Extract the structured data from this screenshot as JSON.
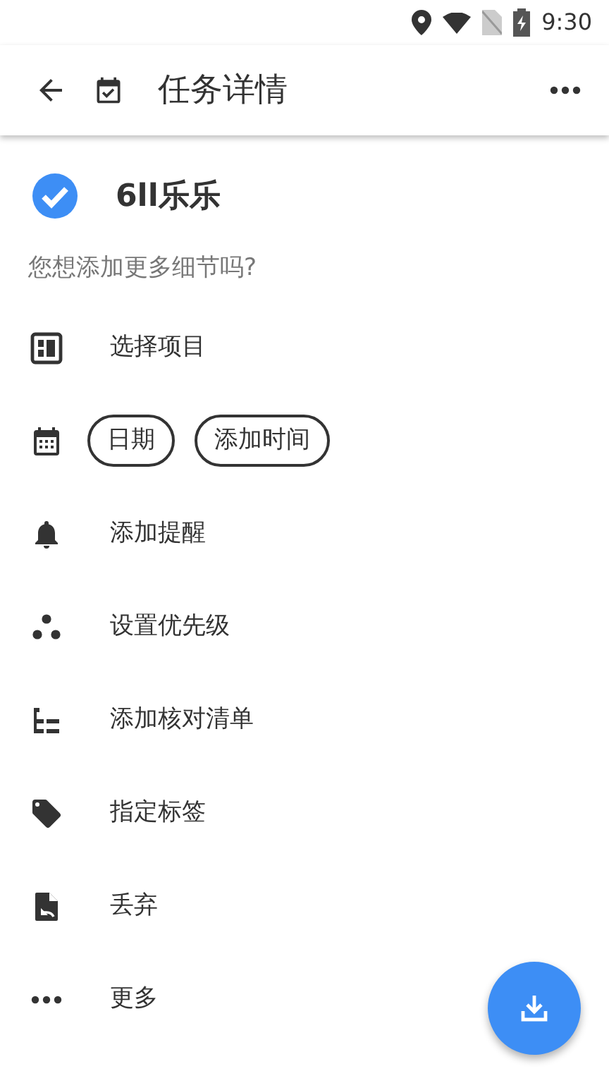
{
  "status_bar": {
    "time": "9:30"
  },
  "toolbar": {
    "title": "任务详情"
  },
  "task": {
    "title": "6ll乐乐",
    "completed": true
  },
  "hint": "您想添加更多细节吗?",
  "rows": [
    {
      "kind": "plain",
      "label": "选择项目"
    },
    {
      "kind": "chips",
      "chips": [
        "日期",
        "添加时间"
      ]
    },
    {
      "kind": "plain",
      "label": "添加提醒"
    },
    {
      "kind": "plain",
      "label": "设置优先级"
    },
    {
      "kind": "plain",
      "label": "添加核对清单"
    },
    {
      "kind": "plain",
      "label": "指定标签"
    },
    {
      "kind": "plain",
      "label": "丢弃"
    },
    {
      "kind": "plain",
      "label": "更多"
    }
  ]
}
